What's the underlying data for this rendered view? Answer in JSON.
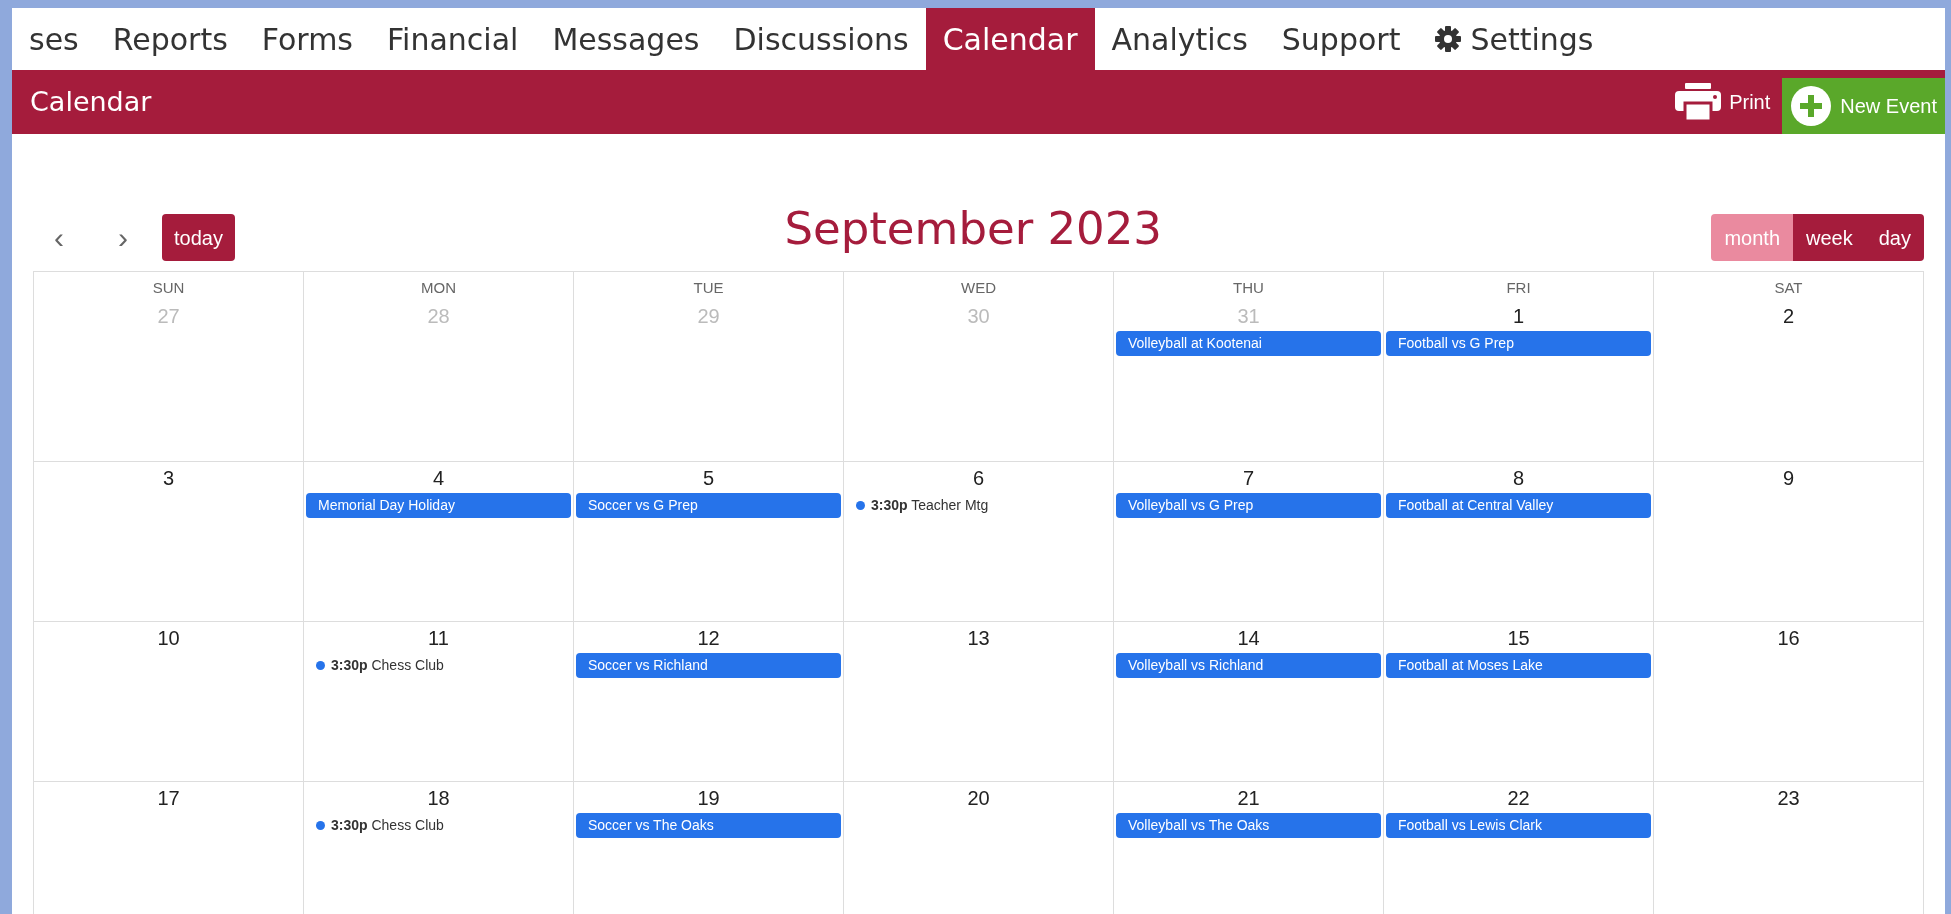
{
  "nav_tabs": [
    {
      "label": "ses",
      "selected": false,
      "icon": false
    },
    {
      "label": "Reports",
      "selected": false,
      "icon": false
    },
    {
      "label": "Forms",
      "selected": false,
      "icon": false
    },
    {
      "label": "Financial",
      "selected": false,
      "icon": false
    },
    {
      "label": "Messages",
      "selected": false,
      "icon": false
    },
    {
      "label": "Discussions",
      "selected": false,
      "icon": false
    },
    {
      "label": "Calendar",
      "selected": true,
      "icon": false
    },
    {
      "label": "Analytics",
      "selected": false,
      "icon": false
    },
    {
      "label": "Support",
      "selected": false,
      "icon": false
    },
    {
      "label": "Settings",
      "selected": false,
      "icon": true
    }
  ],
  "header": {
    "title": "Calendar",
    "print": "Print",
    "new_event": "New Event"
  },
  "toolbar": {
    "prev": "‹",
    "next": "›",
    "today": "today",
    "title": "September 2023",
    "views": [
      {
        "label": "month",
        "selected": true
      },
      {
        "label": "week",
        "selected": false
      },
      {
        "label": "day",
        "selected": false
      }
    ]
  },
  "weekdays": [
    "SUN",
    "MON",
    "TUE",
    "WED",
    "THU",
    "FRI",
    "SAT"
  ],
  "weeks": [
    [
      {
        "day": "27",
        "other_month": true
      },
      {
        "day": "28",
        "other_month": true
      },
      {
        "day": "29",
        "other_month": true
      },
      {
        "day": "30",
        "other_month": true
      },
      {
        "day": "31",
        "other_month": true,
        "events": [
          {
            "kind": "bar",
            "title": "Volleyball at Kootenai"
          }
        ]
      },
      {
        "day": "1",
        "other_month": false,
        "events": [
          {
            "kind": "bar",
            "title": "Football vs G Prep"
          }
        ]
      },
      {
        "day": "2",
        "other_month": false
      }
    ],
    [
      {
        "day": "3",
        "other_month": false
      },
      {
        "day": "4",
        "other_month": false,
        "events": [
          {
            "kind": "bar",
            "title": "Memorial Day Holiday"
          }
        ]
      },
      {
        "day": "5",
        "other_month": false,
        "events": [
          {
            "kind": "bar",
            "title": "Soccer vs G Prep"
          }
        ]
      },
      {
        "day": "6",
        "other_month": false,
        "events": [
          {
            "kind": "dot",
            "time": "3:30p",
            "title": "Teacher Mtg"
          }
        ]
      },
      {
        "day": "7",
        "other_month": false,
        "events": [
          {
            "kind": "bar",
            "title": "Volleyball vs G Prep"
          }
        ]
      },
      {
        "day": "8",
        "other_month": false,
        "events": [
          {
            "kind": "bar",
            "title": "Football at Central Valley"
          }
        ]
      },
      {
        "day": "9",
        "other_month": false
      }
    ],
    [
      {
        "day": "10",
        "other_month": false
      },
      {
        "day": "11",
        "other_month": false,
        "events": [
          {
            "kind": "dot",
            "time": "3:30p",
            "title": "Chess Club"
          }
        ]
      },
      {
        "day": "12",
        "other_month": false,
        "events": [
          {
            "kind": "bar",
            "title": "Soccer vs Richland"
          }
        ]
      },
      {
        "day": "13",
        "other_month": false
      },
      {
        "day": "14",
        "other_month": false,
        "events": [
          {
            "kind": "bar",
            "title": "Volleyball vs Richland"
          }
        ]
      },
      {
        "day": "15",
        "other_month": false,
        "events": [
          {
            "kind": "bar",
            "title": "Football at Moses Lake"
          }
        ]
      },
      {
        "day": "16",
        "other_month": false
      }
    ],
    [
      {
        "day": "17",
        "other_month": false
      },
      {
        "day": "18",
        "other_month": false,
        "events": [
          {
            "kind": "dot",
            "time": "3:30p",
            "title": "Chess Club"
          }
        ]
      },
      {
        "day": "19",
        "other_month": false,
        "events": [
          {
            "kind": "bar",
            "title": "Soccer vs The Oaks"
          }
        ]
      },
      {
        "day": "20",
        "other_month": false
      },
      {
        "day": "21",
        "other_month": false,
        "events": [
          {
            "kind": "bar",
            "title": "Volleyball vs The Oaks"
          }
        ]
      },
      {
        "day": "22",
        "other_month": false,
        "events": [
          {
            "kind": "bar",
            "title": "Football vs Lewis Clark"
          }
        ]
      },
      {
        "day": "23",
        "other_month": false
      }
    ]
  ]
}
